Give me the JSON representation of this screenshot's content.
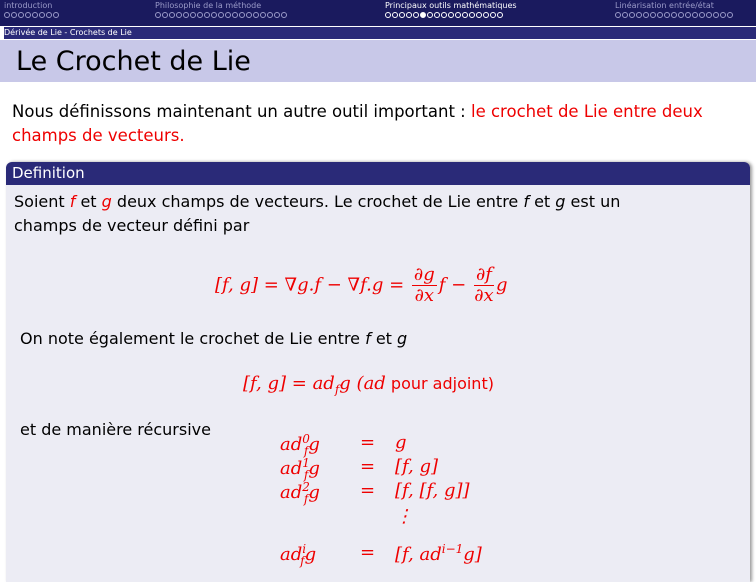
{
  "nav": {
    "sections": [
      {
        "label": "introduction",
        "dots": 8,
        "filled": -1,
        "active": false
      },
      {
        "label": "Philosophie de la méthode",
        "dots": 19,
        "filled": -1,
        "active": false
      },
      {
        "label": "Principaux outils mathématiques",
        "dots": 17,
        "filled": 5,
        "active": true
      },
      {
        "label": "Linéarisation entrée/état",
        "dots": 17,
        "filled": -1,
        "active": false
      }
    ]
  },
  "subsection": "Dérivée de Lie - Crochets de Lie",
  "title": "Le Crochet de Lie",
  "intro": {
    "text": "Nous définissons maintenant un autre outil important : ",
    "highlight": "le crochet de Lie entre deux champs de vecteurs."
  },
  "definition": {
    "header": "Definition",
    "line1_pre": "Soient ",
    "f": "f",
    "et": " et ",
    "g": "g",
    "line1_post": " deux champs de vecteurs. Le crochet de Lie entre ",
    "line1_post2": " est un",
    "line2": "champs de vecteur défini par",
    "eq1": {
      "lhs": "[f, g] = ∇g.f − ∇f.g = ",
      "frac1_num": "∂g",
      "frac1_den": "∂x",
      "mid": "f − ",
      "frac2_num": "∂f",
      "frac2_den": "∂x",
      "end": "g"
    },
    "note": "On note également le crochet de Lie entre ",
    "eq2": {
      "lhs": "[f, g] = ",
      "ad": "ad",
      "sub": "f",
      "g": "g (",
      "ad2": "ad",
      "rest": " pour adjoint)"
    },
    "recursive_label": "et de manière récursive",
    "recursive": [
      {
        "sup": "0",
        "rhs": "g"
      },
      {
        "sup": "1",
        "rhs": "[f, g]"
      },
      {
        "sup": "2",
        "rhs": "[f, [f, g]]"
      },
      {
        "sup": "",
        "rhs": "⋮"
      },
      {
        "sup": "i",
        "rhs": "[f, ad",
        "rhs_sup": "i−1",
        "rhs_end": "g]"
      }
    ]
  }
}
